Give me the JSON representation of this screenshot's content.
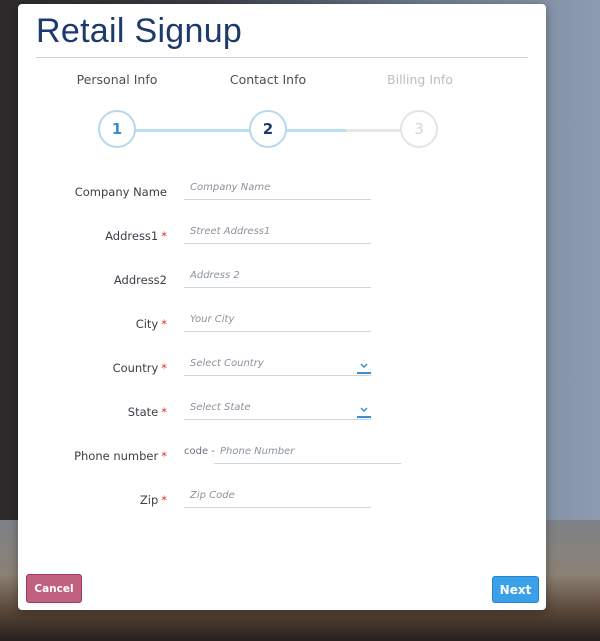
{
  "header": {
    "title": "Retail Signup"
  },
  "steps": [
    {
      "number": "1",
      "label": "Personal Info",
      "state": "completed"
    },
    {
      "number": "2",
      "label": "Contact Info",
      "state": "active"
    },
    {
      "number": "3",
      "label": "Billing Info",
      "state": "disabled"
    }
  ],
  "form": {
    "company_name": {
      "label": "Company Name",
      "placeholder": "Company Name",
      "value": ""
    },
    "address1": {
      "label": "Address1",
      "required": "*",
      "placeholder": "Street Address1",
      "value": ""
    },
    "address2": {
      "label": "Address2",
      "placeholder": "Address 2",
      "value": ""
    },
    "city": {
      "label": "City",
      "required": "*",
      "placeholder": "Your City",
      "value": ""
    },
    "country": {
      "label": "Country",
      "required": "*",
      "placeholder": "Select Country",
      "value": ""
    },
    "state": {
      "label": "State",
      "required": "*",
      "placeholder": "Select State",
      "value": ""
    },
    "phone": {
      "label": "Phone number",
      "required": "*",
      "code_label": "code -",
      "placeholder": "Phone Number",
      "value": ""
    },
    "zip": {
      "label": "Zip",
      "required": "*",
      "placeholder": "Zip Code",
      "value": ""
    }
  },
  "buttons": {
    "cancel": "Cancel",
    "next": "Next"
  },
  "colors": {
    "title": "#1c3a6b",
    "step_line_active": "#b9e1ed",
    "required": "#d9302f",
    "cancel_button": "#c06180",
    "next_button": "#3aa0ea"
  },
  "icons": {
    "dropdown": "chevron-down-icon"
  }
}
